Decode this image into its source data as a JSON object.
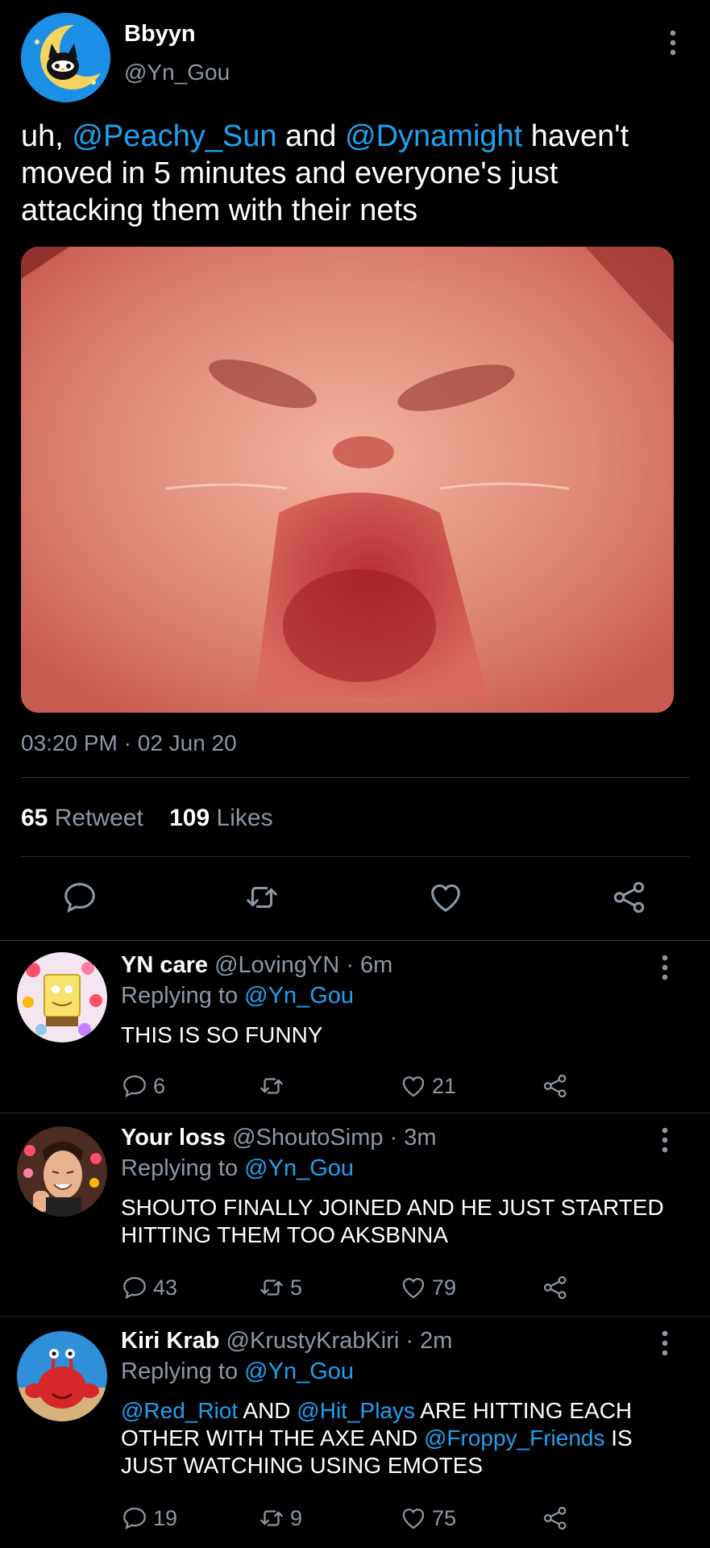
{
  "tweet": {
    "display_name": "Bbyyn",
    "handle": "@Yn_Gou",
    "text_before_1": "uh, ",
    "mention_1": "@Peachy_Sun",
    "text_between": " and ",
    "mention_2": "@Dynamight",
    "text_after": " haven't moved in 5 minutes and everyone's just attacking them with their nets",
    "time": "03:20 PM",
    "separator": " · ",
    "date": "02 Jun 20",
    "retweet_count": "65",
    "retweet_label": "Retweet",
    "likes_count": "109",
    "likes_label": "Likes"
  },
  "replies": [
    {
      "name": "YN care",
      "handle": "@LovingYN",
      "time": " · 6m",
      "replying_label": "Replying to ",
      "replying_to": "@Yn_Gou",
      "text": "THIS IS SO FUNNY",
      "reply_count": "6",
      "retweet_count": "",
      "like_count": "21"
    },
    {
      "name": "Your loss",
      "handle": "@ShoutoSimp",
      "time": " · 3m",
      "replying_label": "Replying to ",
      "replying_to": "@Yn_Gou",
      "text": "SHOUTO FINALLY JOINED AND HE JUST STARTED HITTING THEM TOO AKSBNNA",
      "reply_count": "43",
      "retweet_count": "5",
      "like_count": "79"
    },
    {
      "name": "Kiri Krab",
      "handle": "@KrustyKrabKiri",
      "time": " · 2m",
      "replying_label": "Replying to ",
      "replying_to": "@Yn_Gou",
      "mention_1": "@Red_Riot",
      "text_1": " AND ",
      "mention_2": "@Hit_Plays",
      "text_2": " ARE HITTING EACH OTHER WITH THE AXE AND ",
      "mention_3": "@Froppy_Friends",
      "text_3": " IS JUST WATCHING USING EMOTES",
      "reply_count": "19",
      "retweet_count": "9",
      "like_count": "75"
    }
  ],
  "icons": {
    "reply": "reply-icon",
    "retweet": "retweet-icon",
    "like": "heart-icon",
    "share": "share-icon",
    "more": "more-vertical-icon"
  },
  "colors": {
    "background": "#000000",
    "link": "#1da1f2",
    "muted": "#8b98a5",
    "divider": "#2f3336"
  }
}
